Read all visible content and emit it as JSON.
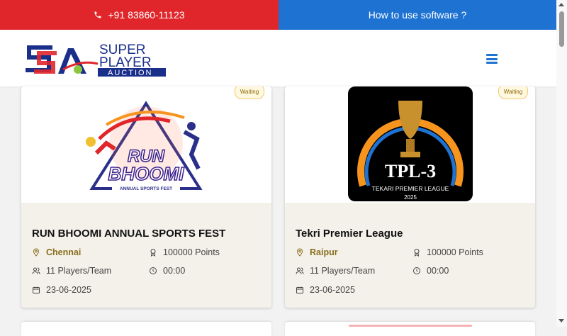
{
  "topbar": {
    "phone": "+91 83860-11123",
    "help_link": "How to use software ?"
  },
  "brand": {
    "line1": "SUPER",
    "line2": "PLAYER",
    "line3": "AUCTION",
    "colors": {
      "red": "#e0262a",
      "blue": "#1e73d2",
      "navy": "#1a2f8a"
    }
  },
  "cards": [
    {
      "title": "RUN BHOOMI ANNUAL SPORTS FEST",
      "status": "Waiting",
      "city": "Chennai",
      "points": "100000 Points",
      "players": "11 Players/Team",
      "time": "00:00",
      "date": "23-06-2025",
      "logo": {
        "line1": "RUN",
        "line2": "BHOOMI",
        "line3": "ANNUAL SPORTS FEST"
      }
    },
    {
      "title": "Tekri Premier League",
      "status": "Waiting",
      "city": "Raipur",
      "points": "100000 Points",
      "players": "11 Players/Team",
      "time": "00:00",
      "date": "23-06-2025",
      "logo": {
        "line1": "TPL-3",
        "line2": "TEKARI PREMIER LEAGUE",
        "line3": "2025"
      }
    }
  ]
}
